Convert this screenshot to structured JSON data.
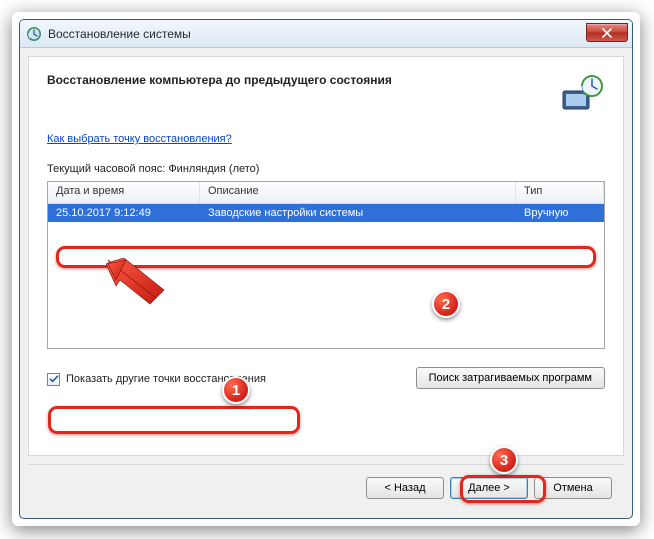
{
  "window": {
    "title": "Восстановление системы"
  },
  "header": {
    "title": "Восстановление компьютера до предыдущего состояния"
  },
  "link": {
    "choose_point": "Как выбрать точку восстановления?"
  },
  "timezone": {
    "label": "Текущий часовой пояс: Финляндия (лето)"
  },
  "table": {
    "columns": {
      "date": "Дата и время",
      "desc": "Описание",
      "type": "Тип"
    },
    "rows": [
      {
        "date": "25.10.2017 9:12:49",
        "desc": "Заводские настройки системы",
        "type": "Вручную"
      }
    ]
  },
  "checkbox": {
    "show_more": "Показать другие точки восстановления",
    "checked": true
  },
  "buttons": {
    "scan": "Поиск затрагиваемых программ",
    "back": "< Назад",
    "next": "Далее >",
    "cancel": "Отмена"
  },
  "annotations": {
    "b1": "1",
    "b2": "2",
    "b3": "3"
  }
}
